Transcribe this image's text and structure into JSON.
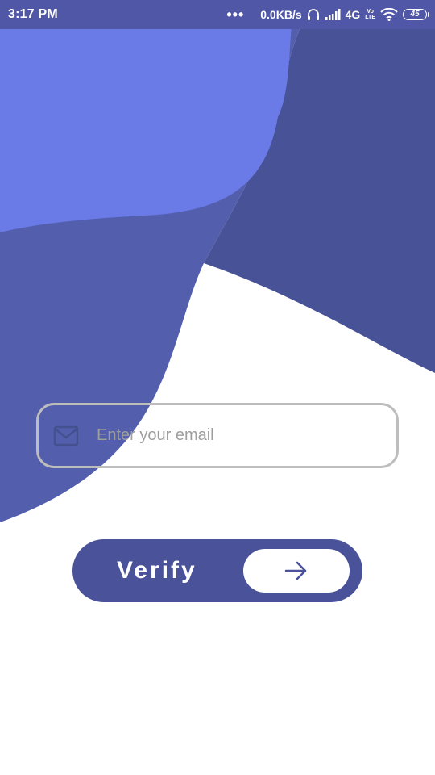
{
  "status_bar": {
    "time": "3:17 PM",
    "more_indicator": "•••",
    "network_speed": "0.0KB/s",
    "network_type": "4G",
    "volte_top": "Vo",
    "volte_bottom": "LTE",
    "battery_level": "45",
    "icons": [
      "headphones-icon",
      "signal-icon",
      "wifi-icon",
      "battery-icon"
    ]
  },
  "form": {
    "email_placeholder": "Enter your email",
    "email_value": "",
    "email_icon": "mail-icon"
  },
  "verify_button": {
    "label": "Verify",
    "arrow_icon": "arrow-right-icon"
  },
  "colors": {
    "status_bar": "#4f57a6",
    "light_blob": "#6a7ae6",
    "mid_blob": "#535fad",
    "dark_blob": "#485296",
    "button": "#4a5299",
    "field_border": "#bdbdbd",
    "placeholder": "#9e9e9e"
  }
}
